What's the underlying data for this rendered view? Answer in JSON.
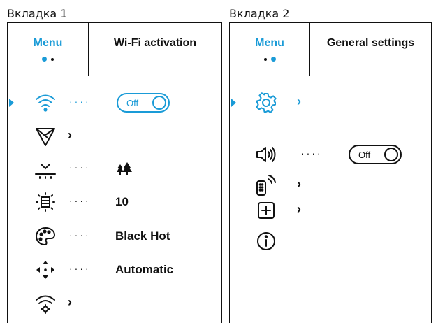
{
  "tabs": [
    {
      "caption": "Вкладка 1",
      "menu_label": "Menu",
      "title": "Wi-Fi activation",
      "rows": [
        {
          "icon": "wifi-icon",
          "value": "Off",
          "control": "toggle",
          "selected": true
        },
        {
          "icon": "triangle-filter-icon",
          "value": "",
          "control": "submenu"
        },
        {
          "icon": "terrain-mode-icon",
          "value": "trees-icon",
          "control": "value"
        },
        {
          "icon": "brightness-screen-icon",
          "value": "10",
          "control": "value"
        },
        {
          "icon": "palette-icon",
          "value": "Black Hot",
          "control": "value"
        },
        {
          "icon": "calibration-icon",
          "value": "Automatic",
          "control": "value"
        },
        {
          "icon": "wifi-settings-icon",
          "value": "",
          "control": "submenu"
        }
      ]
    },
    {
      "caption": "Вкладка 2",
      "menu_label": "Menu",
      "title": "General settings",
      "rows": [
        {
          "icon": "gear-icon",
          "value": "",
          "control": "submenu",
          "selected": true
        },
        {
          "icon": "speaker-icon",
          "value": "Off",
          "control": "toggle"
        },
        {
          "icon": "remote-control-icon",
          "value": "",
          "control": "submenu"
        },
        {
          "icon": "plus-box-icon",
          "value": "",
          "control": "submenu"
        },
        {
          "icon": "info-icon",
          "value": "",
          "control": "none"
        }
      ]
    }
  ],
  "symbols": {
    "leader": "····",
    "chevron": "›",
    "pointer": "▶"
  },
  "colors": {
    "accent": "#1a9bd7",
    "text": "#111111",
    "border": "#111111",
    "background": "#ffffff"
  }
}
